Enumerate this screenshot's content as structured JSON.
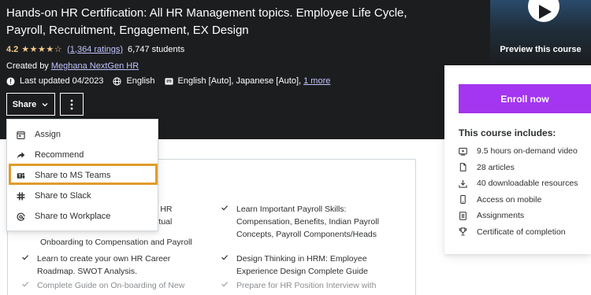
{
  "course": {
    "title": "Hands-on HR Certification: All HR Management topics. Employee Life Cycle, Payroll, Recruitment, Engagement, EX Design",
    "rating": "4.2",
    "stars": "★★★★☆",
    "ratings_count": "(1,364 ratings)",
    "students": "6,747 students",
    "created_prefix": "Created by ",
    "author": "Meghana NextGen HR",
    "last_updated": "Last updated 04/2023",
    "language": "English",
    "captions": "English [Auto], Japanese [Auto],",
    "more_link": "1 more"
  },
  "actions": {
    "share_label": "Share",
    "more_icon": "more-vertical-icon"
  },
  "share_menu": {
    "items": [
      {
        "label": "Assign",
        "icon": "calendar-icon"
      },
      {
        "label": "Recommend",
        "icon": "share-arrow-icon"
      },
      {
        "label": "Share to MS Teams",
        "icon": "teams-icon"
      },
      {
        "label": "Share to Slack",
        "icon": "slack-icon"
      },
      {
        "label": "Share to Workplace",
        "icon": "workplace-icon"
      }
    ],
    "highlight_color": "#e09c2b"
  },
  "preview": {
    "label": "Preview this course"
  },
  "sidebar": {
    "enroll_label": "Enroll now",
    "accent_color": "#a435f0",
    "includes_title": "This course includes:",
    "includes": [
      {
        "label": "9.5 hours on-demand video",
        "icon": "video-icon"
      },
      {
        "label": "28 articles",
        "icon": "file-icon"
      },
      {
        "label": "40 downloadable resources",
        "icon": "download-icon"
      },
      {
        "label": "Access on mobile",
        "icon": "mobile-icon"
      },
      {
        "label": "Assignments",
        "icon": "assignment-icon"
      },
      {
        "label": "Certificate of completion",
        "icon": "trophy-icon"
      }
    ]
  },
  "learn": {
    "left": [
      {
        "line1": "s for HR",
        "line2": "n Virtual",
        "line3": "Onboarding to Compensation and Payroll"
      },
      {
        "line1": "Learn to create your own HR Career",
        "line2": "Roadmap. SWOT Analysis."
      },
      {
        "line1": "Complete Guide on On-boarding of New"
      }
    ],
    "right": [
      {
        "line1": "Learn Important Payroll Skills:",
        "line2": "Compensation, Benefits, Indian Payroll",
        "line3": "Concepts, Payroll Components/Heads"
      },
      {
        "line1": "Design Thinking in HRM: Employee",
        "line2": "Experience Design Complete Guide"
      },
      {
        "line1": "Prepare for HR Position Interview with"
      }
    ]
  }
}
